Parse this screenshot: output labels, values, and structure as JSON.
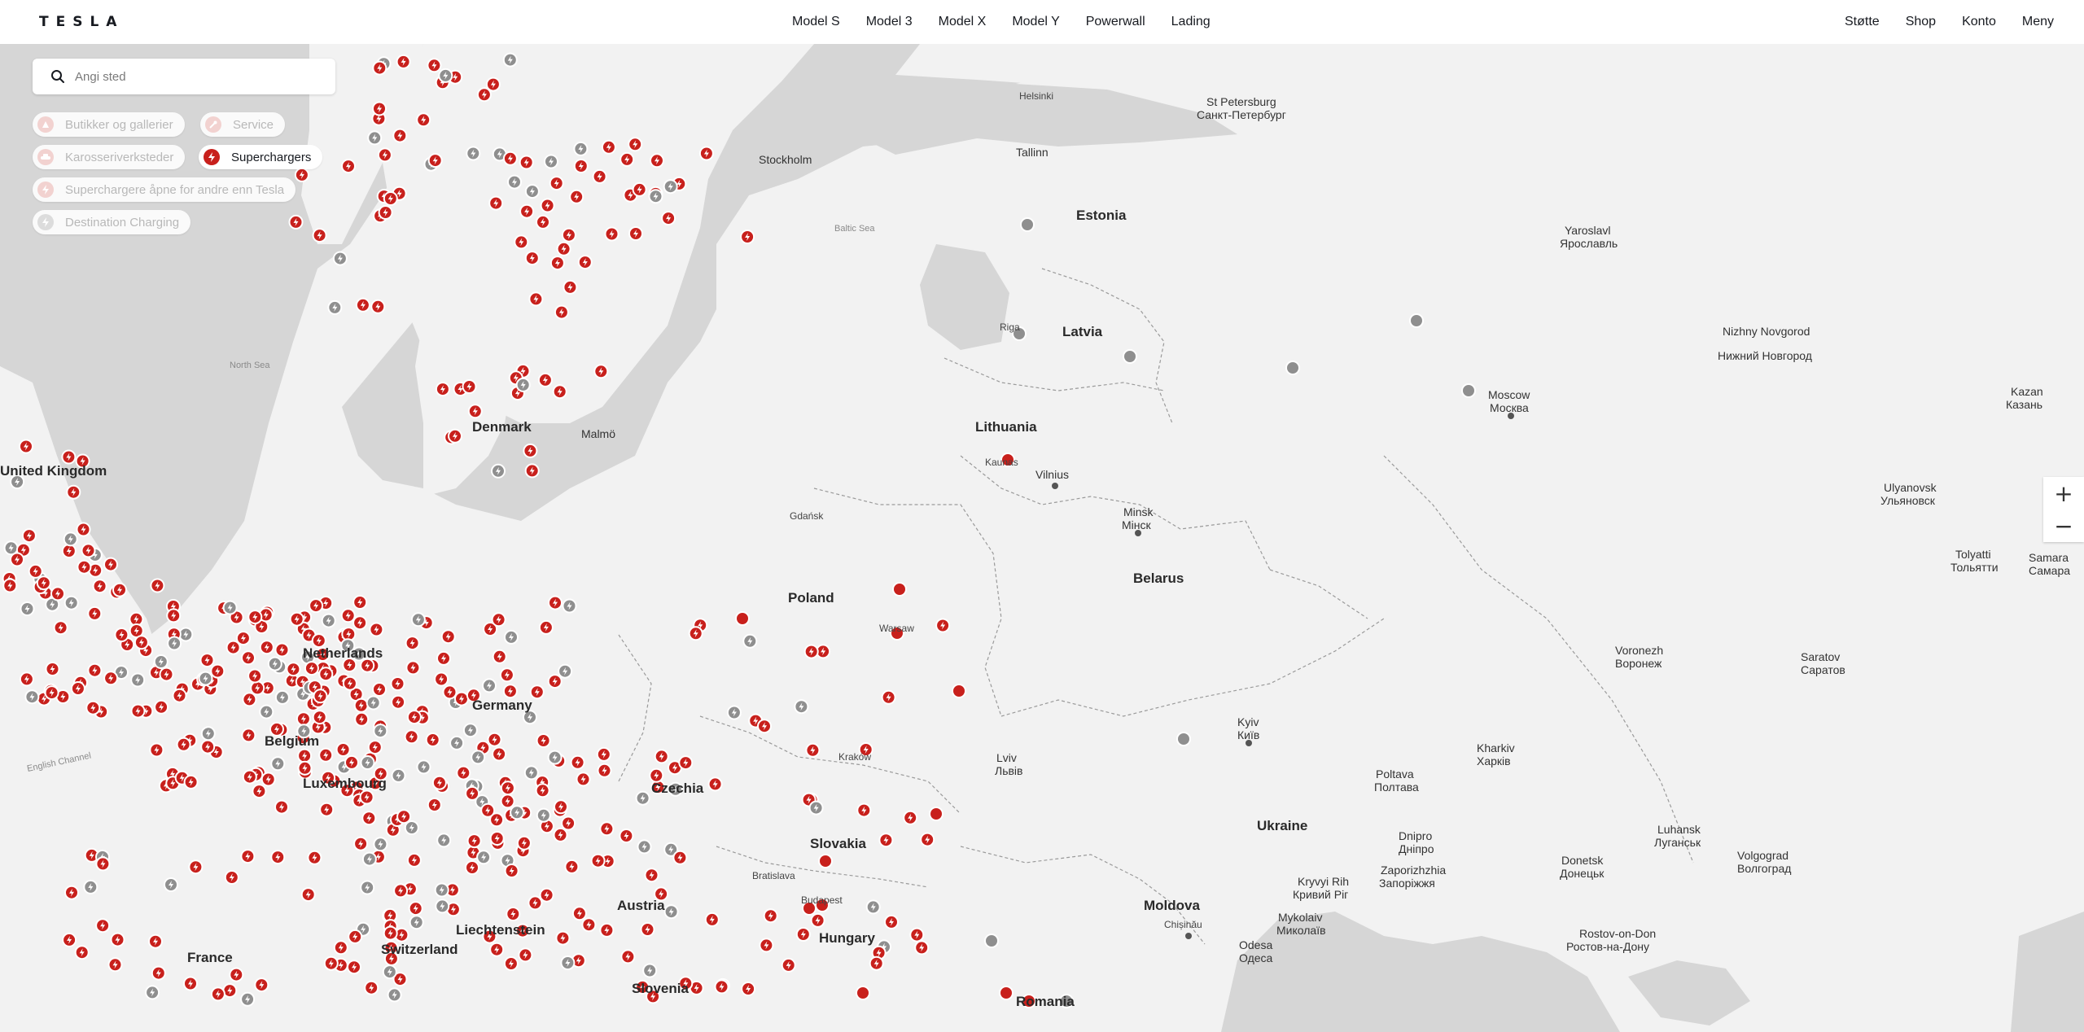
{
  "header": {
    "logo": "TESLA",
    "nav_center": [
      "Model S",
      "Model 3",
      "Model X",
      "Model Y",
      "Powerwall",
      "Lading"
    ],
    "nav_right": [
      "Støtte",
      "Shop",
      "Konto",
      "Meny"
    ]
  },
  "search": {
    "placeholder": "Angi sted"
  },
  "filters": [
    {
      "label": "Butikker og gallerier",
      "active": false
    },
    {
      "label": "Service",
      "active": false
    },
    {
      "label": "Karosseriverksteder",
      "active": false
    },
    {
      "label": "Superchargers",
      "active": true
    },
    {
      "label": "Superchargere åpne for andre enn Tesla",
      "active": false
    },
    {
      "label": "Destination Charging",
      "active": false
    }
  ],
  "zoom": {
    "in": "+",
    "out": "−"
  },
  "colors": {
    "supercharger": "#c8201c",
    "destination": "#8f8f8f",
    "land": "#f2f2f2",
    "water": "#d6d6d6"
  },
  "map": {
    "countries": [
      {
        "name": "Estonia"
      },
      {
        "name": "Latvia"
      },
      {
        "name": "Lithuania"
      },
      {
        "name": "Poland"
      },
      {
        "name": "Belarus"
      },
      {
        "name": "Ukraine"
      },
      {
        "name": "Moldova"
      },
      {
        "name": "Slovakia"
      },
      {
        "name": "Hungary"
      },
      {
        "name": "Austria"
      },
      {
        "name": "Slovenia"
      },
      {
        "name": "Czechia"
      },
      {
        "name": "Germany"
      },
      {
        "name": "Netherlands"
      },
      {
        "name": "Belgium"
      },
      {
        "name": "Luxembourg"
      },
      {
        "name": "Liechtenstein"
      },
      {
        "name": "Switzerland"
      },
      {
        "name": "France"
      },
      {
        "name": "United Kingdom"
      },
      {
        "name": "Denmark"
      },
      {
        "name": "Romania"
      }
    ],
    "seas": [
      "Baltic Sea",
      "North Sea",
      "English Channel"
    ],
    "cities": [
      {
        "name": "St Petersburg",
        "local": "Санкт-Петербург"
      },
      {
        "name": "Moscow",
        "local": "Москва"
      },
      {
        "name": "Minsk",
        "local": "Мінск"
      },
      {
        "name": "Kyiv",
        "local": "Київ"
      },
      {
        "name": "Kharkiv",
        "local": "Харків"
      },
      {
        "name": "Voronezh",
        "local": "Воронеж"
      },
      {
        "name": "Saratov",
        "local": "Саратов"
      },
      {
        "name": "Samara",
        "local": "Самара"
      },
      {
        "name": "Kazan",
        "local": "Казань"
      },
      {
        "name": "Nizhny Novgorod",
        "local": "Нижний Новгород"
      },
      {
        "name": "Yaroslavl",
        "local": "Ярославль"
      },
      {
        "name": "Tolyatti",
        "local": "Тольятти"
      },
      {
        "name": "Ulyanovsk",
        "local": "Ульяновск"
      },
      {
        "name": "Volgograd",
        "local": "Волгоград"
      },
      {
        "name": "Rostov-on-Don",
        "local": "Ростов-на-Дону"
      },
      {
        "name": "Donetsk",
        "local": "Донецьк"
      },
      {
        "name": "Luhansk",
        "local": "Луганськ"
      },
      {
        "name": "Dnipro",
        "local": "Дніпро"
      },
      {
        "name": "Zaporizhzhia",
        "local": "Запоріжжя"
      },
      {
        "name": "Poltava",
        "local": "Полтава"
      },
      {
        "name": "Odesa",
        "local": "Одеса"
      },
      {
        "name": "Mykolaiv",
        "local": "Миколаїв"
      },
      {
        "name": "Kryvyi Rih",
        "local": "Кривий Ріг"
      },
      {
        "name": "Lviv",
        "local": "Львів"
      },
      {
        "name": "Warsaw",
        "local": ""
      },
      {
        "name": "Vilnius",
        "local": ""
      },
      {
        "name": "Riga",
        "local": ""
      },
      {
        "name": "Tallinn",
        "local": ""
      },
      {
        "name": "Helsinki",
        "local": ""
      },
      {
        "name": "Stockholm",
        "local": ""
      },
      {
        "name": "Gdańsk",
        "local": ""
      },
      {
        "name": "Kraków",
        "local": ""
      },
      {
        "name": "Kaunas",
        "local": ""
      },
      {
        "name": "Bratislava",
        "local": ""
      },
      {
        "name": "Budapest",
        "local": ""
      },
      {
        "name": "Malmö",
        "local": ""
      },
      {
        "name": "Chișinău",
        "local": ""
      }
    ]
  }
}
